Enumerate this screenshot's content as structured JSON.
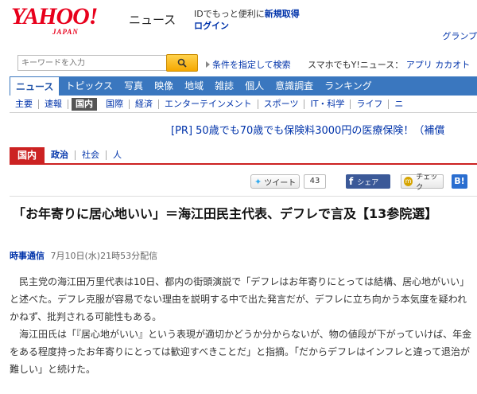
{
  "header": {
    "logo_main": "YAHOO!",
    "logo_sub": "JAPAN",
    "news_label": "ニュース",
    "id_text_prefix": "IDでもっと便利に",
    "id_register": "新規取得",
    "login": "ログイン",
    "gourmet": "グランプ"
  },
  "search": {
    "placeholder": "キーワードを入力",
    "condition_link": "条件を指定して検索",
    "promo_prefix": "スマホでもY!ニュース：",
    "promo_app": "アプリ",
    "promo_cat": "カカオト"
  },
  "main_nav": {
    "items": [
      {
        "label": "ニュース"
      },
      {
        "label": "トピックス"
      },
      {
        "label": "写真"
      },
      {
        "label": "映像"
      },
      {
        "label": "地域"
      },
      {
        "label": "雑誌"
      },
      {
        "label": "個人"
      },
      {
        "label": "意識調査"
      },
      {
        "label": "ランキング"
      }
    ]
  },
  "sub_nav": {
    "items": [
      {
        "label": "主要"
      },
      {
        "label": "速報"
      },
      {
        "label": "国内"
      },
      {
        "label": "国際"
      },
      {
        "label": "経済"
      },
      {
        "label": "エンターテインメント"
      },
      {
        "label": "スポーツ"
      },
      {
        "label": "IT・科学"
      },
      {
        "label": "ライフ"
      },
      {
        "label": "ニ"
      }
    ]
  },
  "pr": {
    "text": "[PR] 50歳でも70歳でも保険料3000円の医療保険！（補償"
  },
  "category": {
    "tag": "国内",
    "items": [
      {
        "label": "政治"
      },
      {
        "label": "社会"
      },
      {
        "label": "人"
      }
    ]
  },
  "social": {
    "tweet_label": "ツイート",
    "tweet_count": "43",
    "fb_label": "シェア",
    "mixi_label": "チェック",
    "hb_label": "B!"
  },
  "article": {
    "headline": "「お年寄りに居心地いい」＝海江田民主代表、デフレで言及【13参院選】",
    "source": "時事通信",
    "date": "7月10日(水)21時53分配信",
    "paragraphs": [
      "民主党の海江田万里代表は10日、都内の街頭演説で「デフレはお年寄りにとっては結構、居心地がいい」と述べた。デフレ克服が容易でない理由を説明する中で出た発言だが、デフレに立ち向かう本気度を疑われかねず、批判される可能性もある。",
      "海江田氏は「『居心地がいい』という表現が適切かどうか分からないが、物の値段が下がっていけば、年金をある程度持ったお年寄りにとっては歓迎すべきことだ」と指摘。「だからデフレはインフレと違って退治が難しい」と続けた。"
    ]
  }
}
